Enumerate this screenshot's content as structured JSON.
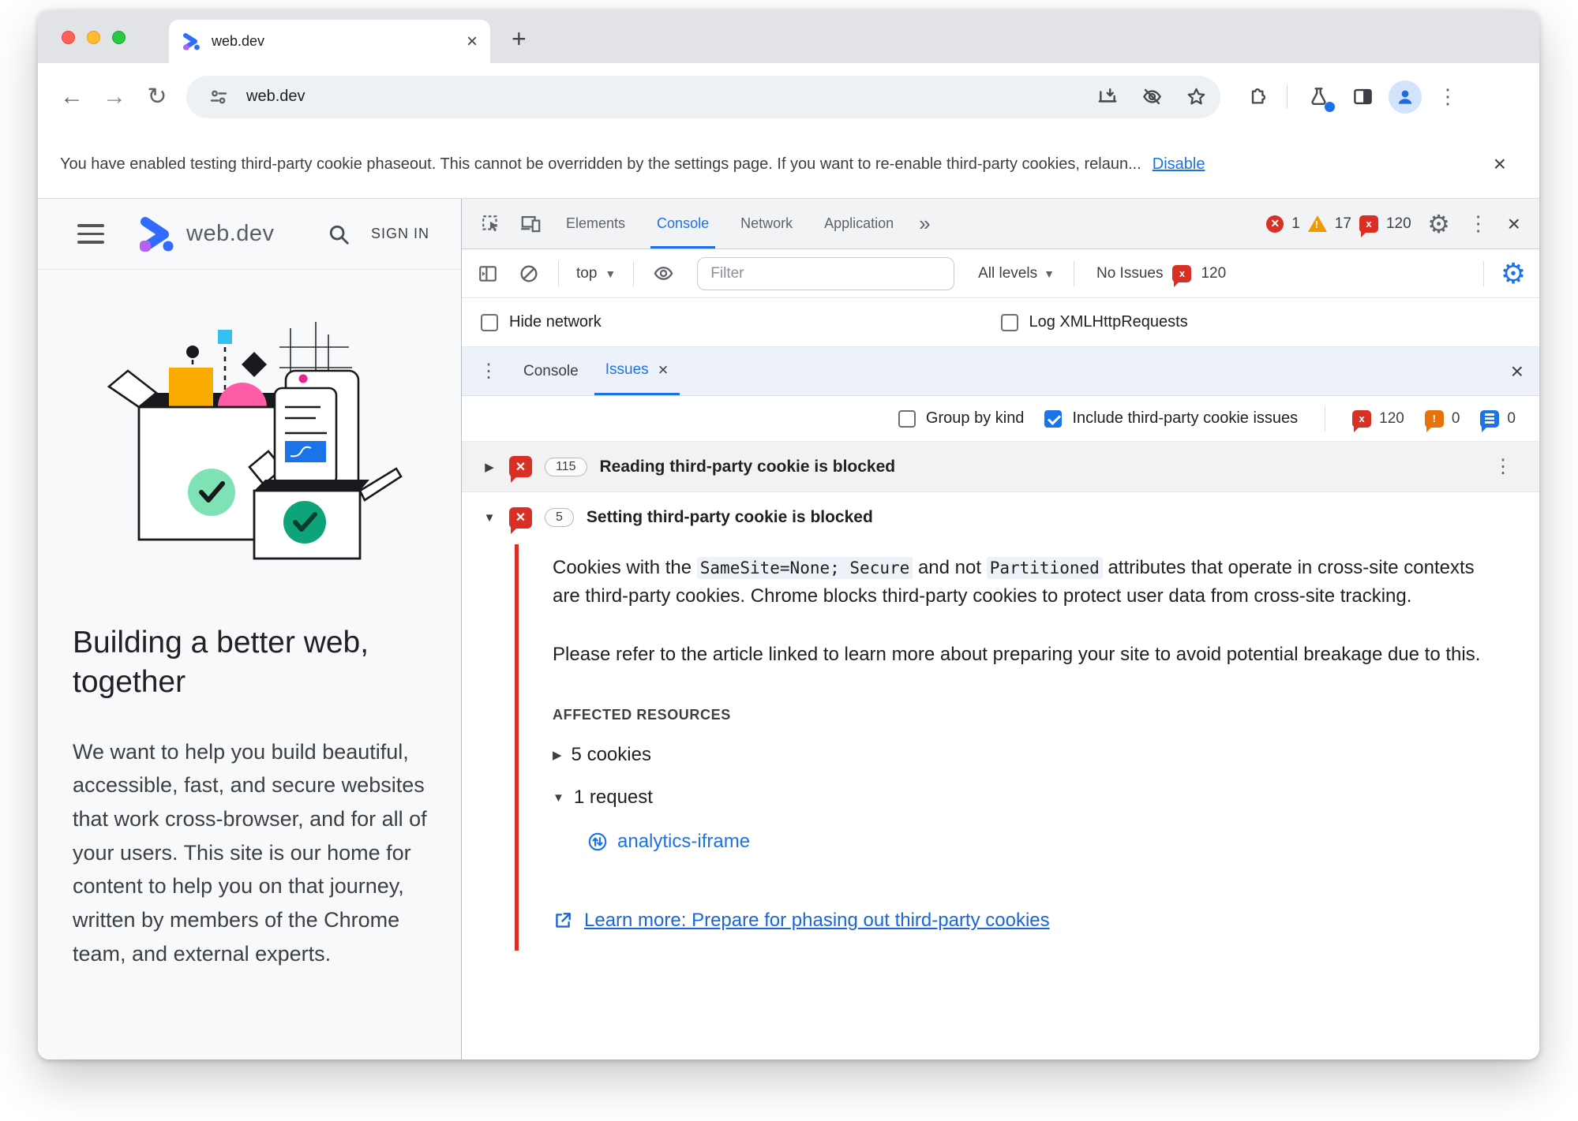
{
  "colors": {
    "accent": "#1a73e8",
    "error": "#d93025",
    "warning": "#e8710a",
    "brand_blue": "#2f6bff",
    "brand_purple": "#b263f6"
  },
  "browser": {
    "tab_title": "web.dev",
    "new_tab": "+",
    "close_glyph": "×",
    "url": "web.dev",
    "infobar_text": "You have enabled testing third-party cookie phaseout. This cannot be overridden by the settings page. If you want to re-enable third-party cookies, relaun...",
    "infobar_action": "Disable"
  },
  "site": {
    "brand": "web.dev",
    "sign_in": "SIGN IN",
    "hero_title": "Building a better web, together",
    "hero_body": "We want to help you build beautiful, accessible, fast, and secure websites that work cross-browser, and for all of your users. This site is our home for content to help you on that journey, written by members of the Chrome team, and external experts."
  },
  "devtools": {
    "tabs": {
      "elements": "Elements",
      "console": "Console",
      "network": "Network",
      "application": "Application",
      "more": "»"
    },
    "badges": {
      "errors": "1",
      "warnings": "17",
      "issues": "120"
    },
    "console_toolbar": {
      "context": "top",
      "filter_placeholder": "Filter",
      "levels": "All levels",
      "no_issues": "No Issues",
      "issues_count": "120"
    },
    "options": {
      "hide_network": "Hide network",
      "log_xhr": "Log XMLHttpRequests"
    },
    "drawer_tabs": {
      "console": "Console",
      "issues": "Issues"
    },
    "issues_bar": {
      "group": "Group by kind",
      "include": "Include third-party cookie issues",
      "errors": "120",
      "warnings": "0",
      "messages": "0"
    },
    "issue1": {
      "count": "115",
      "title": "Reading third-party cookie is blocked"
    },
    "issue2": {
      "count": "5",
      "title": "Setting third-party cookie is blocked",
      "p1a": "Cookies with the ",
      "p1code1": "SameSite=None; Secure",
      "p1b": " and not ",
      "p1code2": "Partitioned",
      "p1c": " attributes that operate in cross-site contexts are third-party cookies. Chrome blocks third-party cookies to protect user data from cross-site tracking.",
      "p2": "Please refer to the article linked to learn more about preparing your site to avoid potential breakage due to this.",
      "affected": "AFFECTED RESOURCES",
      "cookies": "5 cookies",
      "request": "1 request",
      "request_link": "analytics-iframe",
      "learn_more": "Learn more: Prepare for phasing out third-party cookies"
    }
  }
}
